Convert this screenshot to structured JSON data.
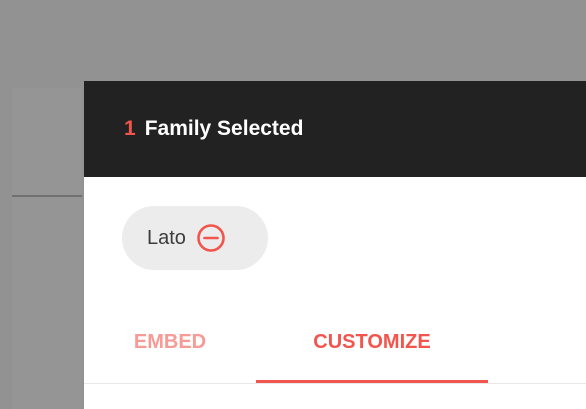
{
  "header": {
    "count": "1",
    "title": "Family Selected"
  },
  "selected_families": [
    {
      "name": "Lato",
      "remove_icon": "remove-circle-icon"
    }
  ],
  "tabs": [
    {
      "label": "EMBED",
      "active": false
    },
    {
      "label": "CUSTOMIZE",
      "active": true
    }
  ],
  "colors": {
    "accent": "#f2554d",
    "accent_muted": "#f89a95",
    "header_background": "#222222",
    "chip_background": "#ececec",
    "backdrop": "#929292"
  }
}
